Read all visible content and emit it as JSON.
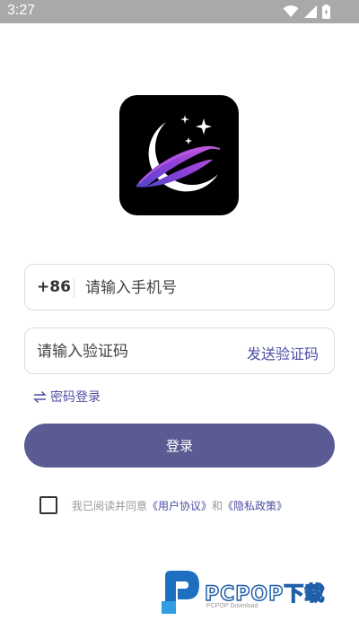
{
  "status_bar": {
    "time": "3:27",
    "icons": [
      "wifi-icon",
      "signal-icon",
      "battery-icon"
    ]
  },
  "logo": {
    "icon": "crescent-moon-logo"
  },
  "phone_field": {
    "country_code": "+86",
    "placeholder": "请输入手机号"
  },
  "code_field": {
    "placeholder": "请输入验证码",
    "send_code_label": "发送验证码"
  },
  "password_login": {
    "icon": "swap-arrows-icon",
    "label": "密码登录"
  },
  "login_button": {
    "label": "登录"
  },
  "agreement": {
    "prefix": "我已阅读并同意",
    "user_agreement": "《用户协议》",
    "and": "和",
    "privacy_policy": "《隐私政策》",
    "checked": false
  },
  "watermark": {
    "title": "PCPOP下载",
    "subtitle": "PCPOP Download"
  },
  "colors": {
    "accent": "#5b5b93",
    "link": "#4d4fa3",
    "status_bar": "#a9a9a9"
  }
}
